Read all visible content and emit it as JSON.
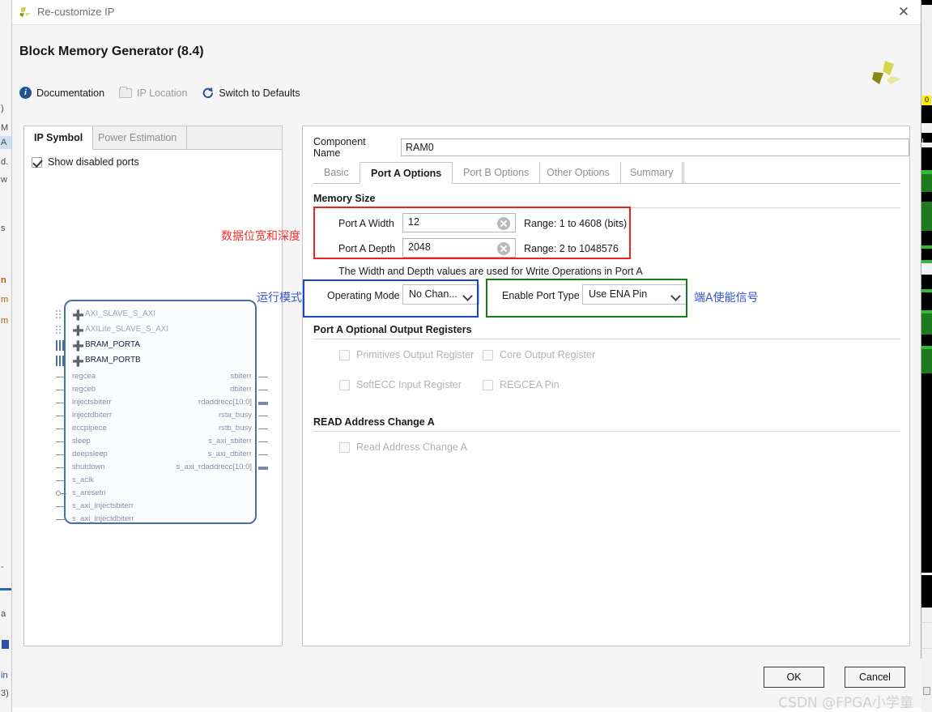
{
  "background": {
    "left_fragments": [
      ")",
      "M",
      "A",
      "d.",
      "w",
      "s",
      "n",
      "m",
      "m",
      "-",
      "a",
      "in",
      "3)"
    ],
    "right_note": "dark-editor-window"
  },
  "titlebar": {
    "title": "Re-customize IP",
    "close_label": "✕",
    "icon": "xilinx-logo-icon"
  },
  "header": {
    "app_title": "Block Memory Generator (8.4)",
    "tools": [
      {
        "label": "Documentation",
        "icon": "info-icon",
        "disabled": false
      },
      {
        "label": "IP Location",
        "icon": "folder-icon",
        "disabled": true
      },
      {
        "label": "Switch to Defaults",
        "icon": "refresh-icon",
        "disabled": false
      }
    ]
  },
  "left_panel": {
    "tabs": [
      {
        "label": "IP Symbol",
        "active": true
      },
      {
        "label": "Power Estimation",
        "active": false
      }
    ],
    "show_disabled_ports": {
      "label": "Show disabled ports",
      "checked": true
    },
    "symbol": {
      "buses": [
        {
          "label": "AXI_SLAVE_S_AXI",
          "enabled": false,
          "marker": "dots"
        },
        {
          "label": "AXILite_SLAVE_S_AXI",
          "enabled": false,
          "marker": "dots"
        },
        {
          "label": "BRAM_PORTA",
          "enabled": true,
          "marker": "bars"
        },
        {
          "label": "BRAM_PORTB",
          "enabled": true,
          "marker": "bars"
        }
      ],
      "inputs": [
        {
          "label": "regcea",
          "marker": "line"
        },
        {
          "label": "regceb",
          "marker": "line"
        },
        {
          "label": "injectsbiterr",
          "marker": "line"
        },
        {
          "label": "injectdbiterr",
          "marker": "line"
        },
        {
          "label": "eccpipece",
          "marker": "line"
        },
        {
          "label": "sleep",
          "marker": "line"
        },
        {
          "label": "deepsleep",
          "marker": "line"
        },
        {
          "label": "shutdown",
          "marker": "line"
        },
        {
          "label": "s_aclk",
          "marker": "line"
        },
        {
          "label": "s_aresetn",
          "marker": "inverted"
        },
        {
          "label": "s_axi_injectsbiterr",
          "marker": "line"
        },
        {
          "label": "s_axi_injectdbiterr",
          "marker": "line"
        }
      ],
      "outputs": [
        {
          "label": "sbiterr",
          "marker": "line"
        },
        {
          "label": "dbiterr",
          "marker": "line"
        },
        {
          "label": "rdaddrecc[10:0]",
          "marker": "bus"
        },
        {
          "label": "rsta_busy",
          "marker": "line"
        },
        {
          "label": "rstb_busy",
          "marker": "line"
        },
        {
          "label": "s_axi_sbiterr",
          "marker": "line"
        },
        {
          "label": "s_axi_dbiterr",
          "marker": "line"
        },
        {
          "label": "s_axi_rdaddrecc[10:0]",
          "marker": "bus"
        }
      ]
    }
  },
  "right_panel": {
    "component_name": {
      "label": "Component Name",
      "value": "RAM0"
    },
    "tabs": [
      {
        "label": "Basic",
        "active": false
      },
      {
        "label": "Port A Options",
        "active": true
      },
      {
        "label": "Port B Options",
        "active": false
      },
      {
        "label": "Other Options",
        "active": false
      },
      {
        "label": "Summary",
        "active": false
      }
    ],
    "memory_size": {
      "title": "Memory Size",
      "width": {
        "label": "Port A Width",
        "value": "12",
        "range": "Range: 1 to 4608 (bits)"
      },
      "depth": {
        "label": "Port A Depth",
        "value": "2048",
        "range": "Range: 2 to 1048576"
      },
      "note": "The Width and Depth values are used for Write Operations in Port A"
    },
    "operating_mode": {
      "label": "Operating Mode",
      "value": "No Chan..."
    },
    "enable_port_type": {
      "label": "Enable Port Type",
      "value": "Use ENA Pin"
    },
    "output_registers": {
      "title": "Port A Optional Output Registers",
      "items": [
        {
          "label": "Primitives Output Register",
          "checked": false,
          "disabled": true
        },
        {
          "label": "Core Output Register",
          "checked": false,
          "disabled": true
        },
        {
          "label": "SoftECC Input Register",
          "checked": false,
          "disabled": true
        },
        {
          "label": "REGCEA Pin",
          "checked": false,
          "disabled": true
        }
      ]
    },
    "read_address_change": {
      "title": "READ Address Change A",
      "items": [
        {
          "label": "Read Address Change A",
          "checked": false,
          "disabled": true
        }
      ]
    }
  },
  "annotations": [
    {
      "text": "数据位宽和深度",
      "color": "#f23030"
    },
    {
      "text": "运行模式",
      "color": "#3355dd"
    },
    {
      "text": "端A使能信号",
      "color": "#3355dd"
    }
  ],
  "highlight_colors": {
    "memory_size_box": "#f02020",
    "operating_mode_box": "#1a44cc",
    "enable_port_box": "#1a7a1a"
  },
  "footer": {
    "ok_label": "OK",
    "cancel_label": "Cancel",
    "watermark": "CSDN @FPGA小学童"
  }
}
